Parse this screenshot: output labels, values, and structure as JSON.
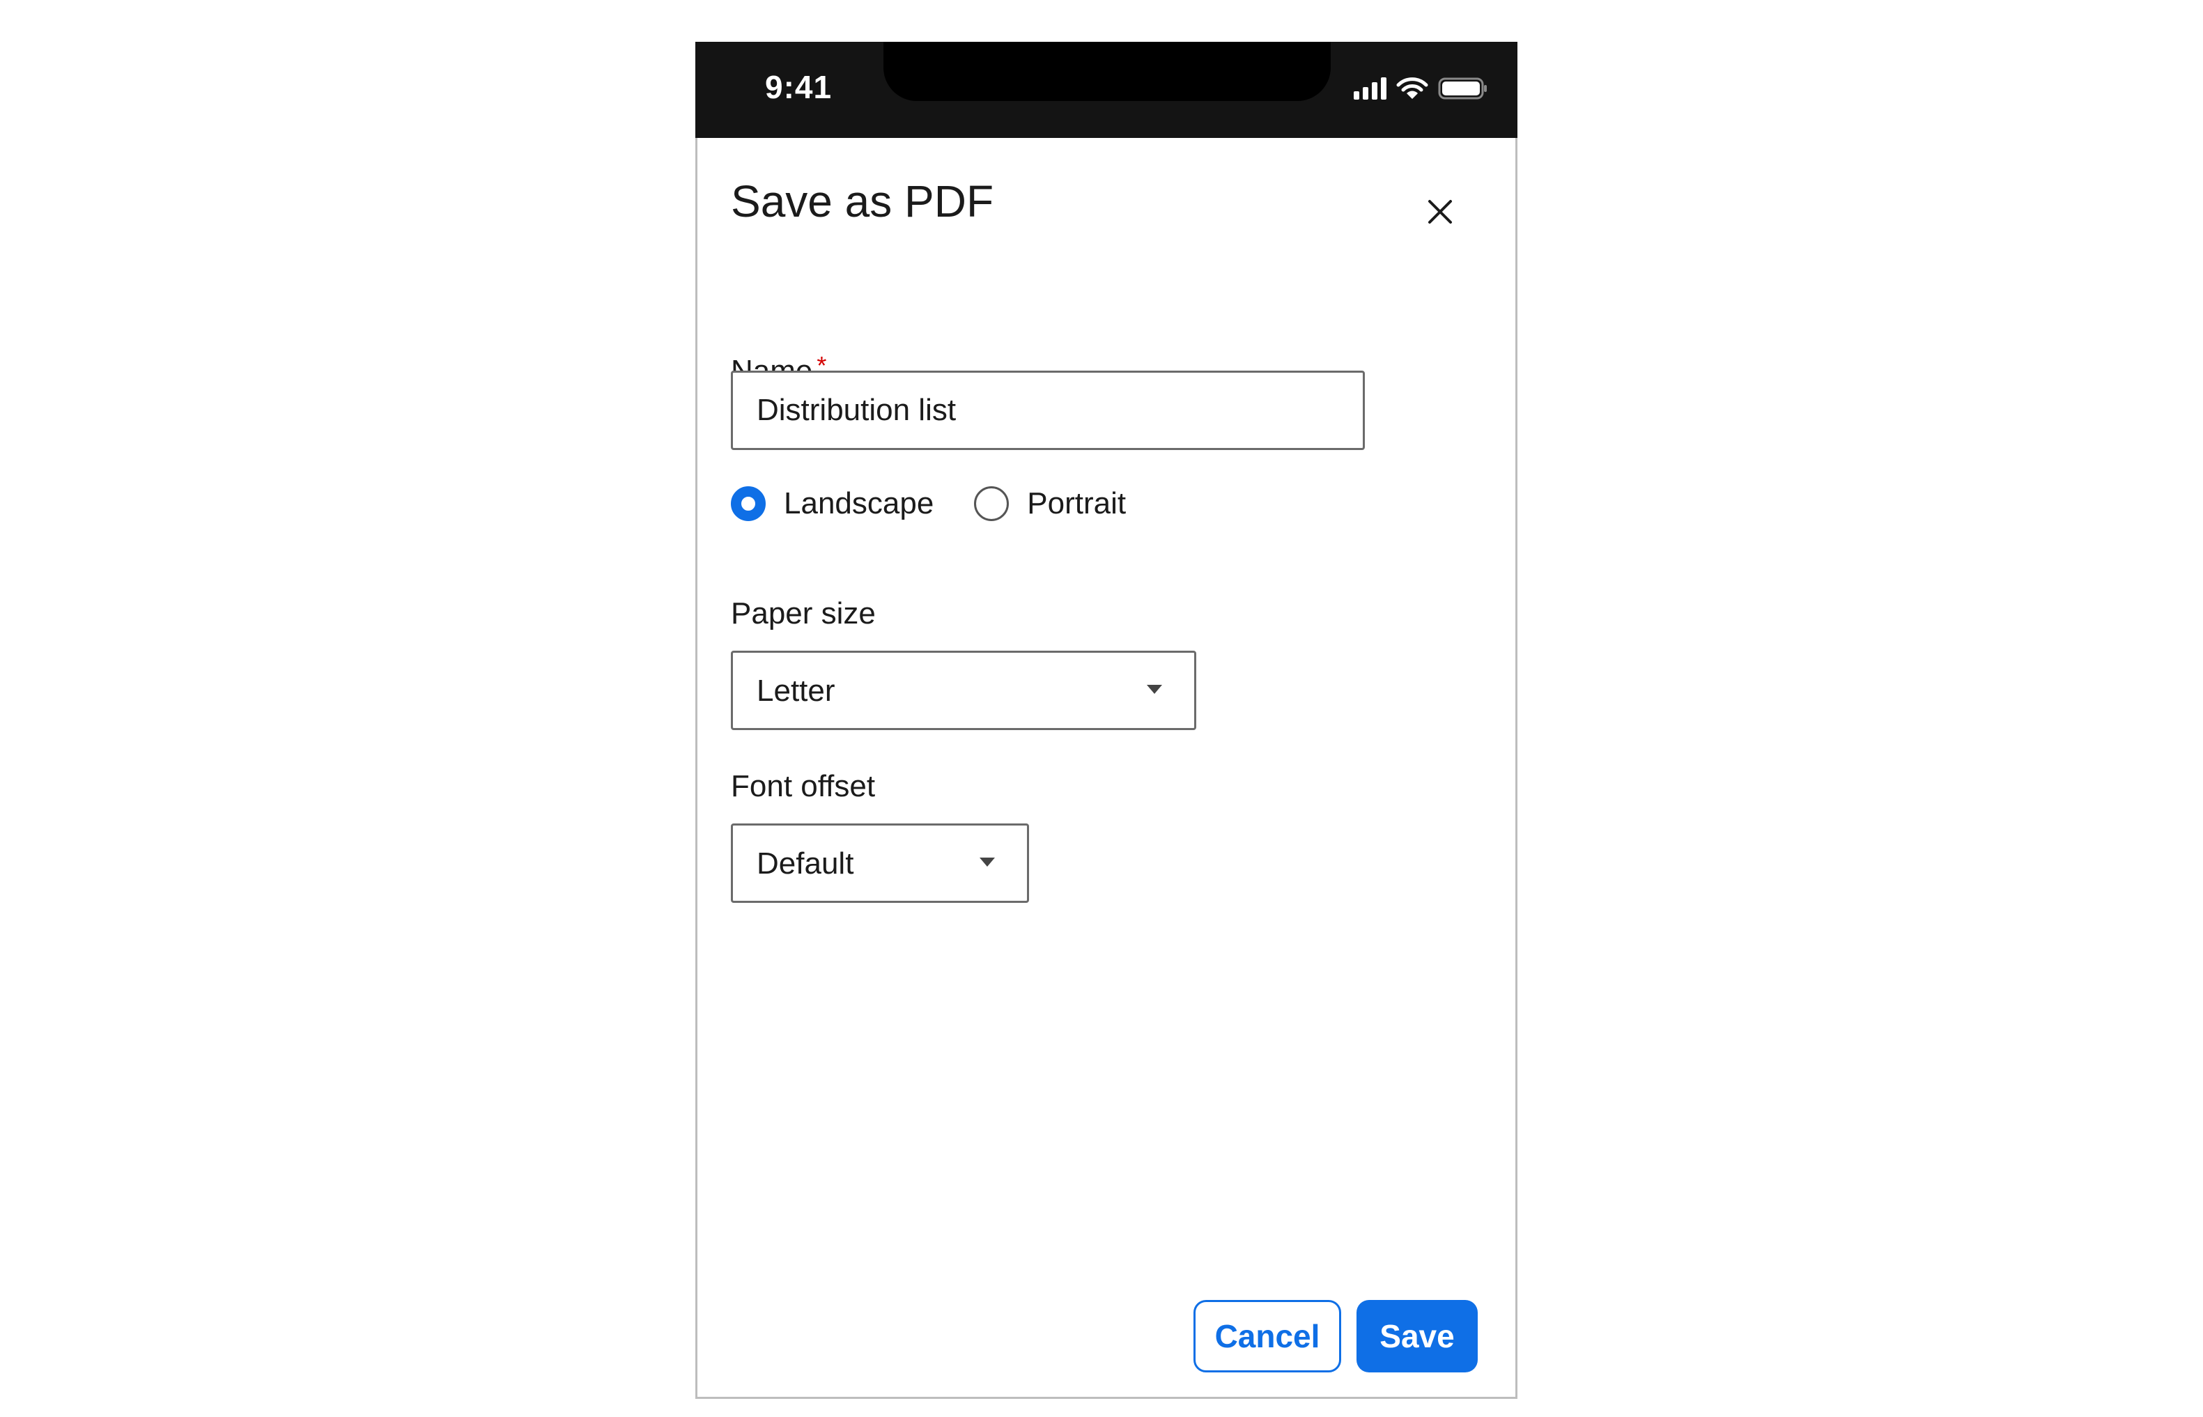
{
  "status_bar": {
    "time": "9:41",
    "icons": [
      "cellular-signal-icon",
      "wifi-icon",
      "battery-icon"
    ]
  },
  "dialog": {
    "title": "Save as PDF",
    "close_icon": "close-icon"
  },
  "name_field": {
    "label": "Name",
    "required_mark": "*",
    "value": "Distribution list"
  },
  "orientation": {
    "options": [
      {
        "label": "Landscape",
        "selected": true
      },
      {
        "label": "Portrait",
        "selected": false
      }
    ]
  },
  "paper_size": {
    "label": "Paper size",
    "value": "Letter"
  },
  "font_offset": {
    "label": "Font offset",
    "value": "Default"
  },
  "actions": {
    "cancel_label": "Cancel",
    "save_label": "Save"
  },
  "colors": {
    "accent": "#0f6fe6",
    "required": "#d40000",
    "status_bar_bg": "#141414"
  }
}
